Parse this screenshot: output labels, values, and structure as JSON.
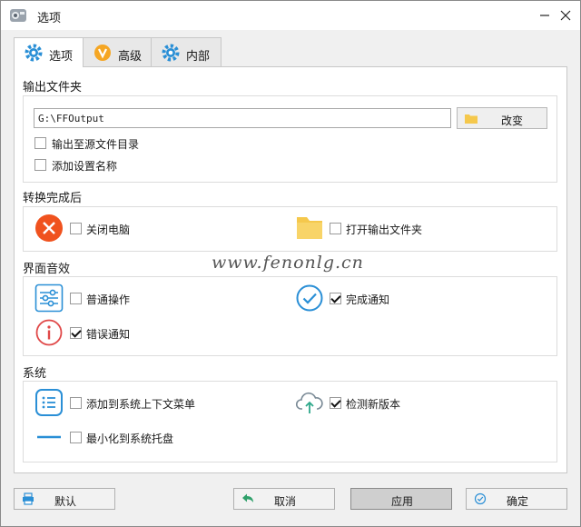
{
  "window": {
    "title": "选项"
  },
  "tabs": [
    {
      "label": "选项",
      "active": true,
      "icon": "gear-icon"
    },
    {
      "label": "高级",
      "active": false,
      "icon": "v-badge-icon"
    },
    {
      "label": "内部",
      "active": false,
      "icon": "gear-icon"
    }
  ],
  "output": {
    "section_title": "输出文件夹",
    "path_value": "G:\\FFOutput",
    "change_label": "改变",
    "to_source_label": "输出至源文件目录",
    "to_source_checked": false,
    "add_setting_name_label": "添加设置名称",
    "add_setting_name_checked": false
  },
  "after_convert": {
    "section_title": "转换完成后",
    "shutdown_label": "关闭电脑",
    "shutdown_checked": false,
    "open_folder_label": "打开输出文件夹",
    "open_folder_checked": false
  },
  "sound": {
    "section_title": "界面音效",
    "normal_label": "普通操作",
    "normal_checked": false,
    "complete_label": "完成通知",
    "complete_checked": true,
    "error_label": "错误通知",
    "error_checked": true
  },
  "system": {
    "section_title": "系统",
    "context_menu_label": "添加到系统上下文菜单",
    "context_menu_checked": false,
    "check_update_label": "检测新版本",
    "check_update_checked": true,
    "minimize_tray_label": "最小化到系统托盘",
    "minimize_tray_checked": false
  },
  "watermark": "www.fenonlg.cn",
  "footer": {
    "default_label": "默认",
    "cancel_label": "取消",
    "apply_label": "应用",
    "ok_label": "确定"
  },
  "colors": {
    "accent_blue": "#2a8fd6",
    "shutdown_red": "#f0521e",
    "folder_yellow": "#f5c84c",
    "error_red": "#e04848",
    "tab_badge_orange": "#f5a623"
  }
}
